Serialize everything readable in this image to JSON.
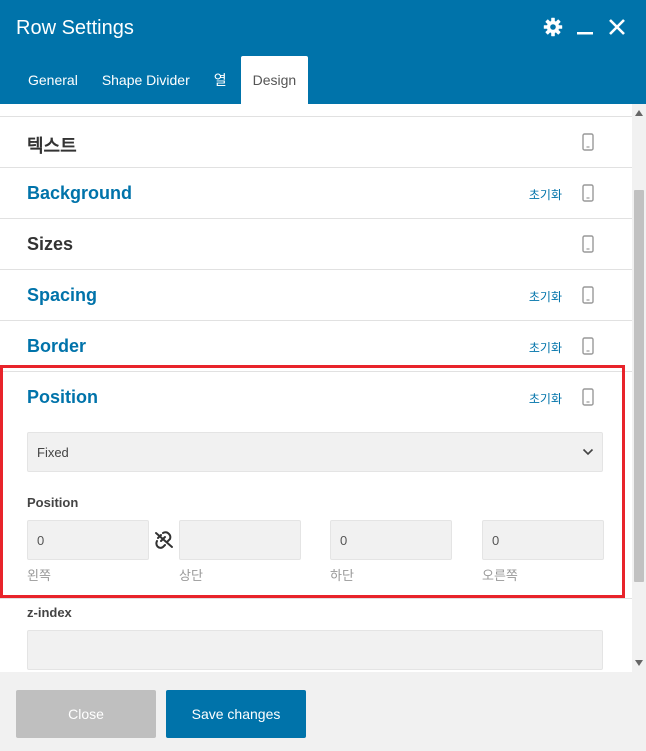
{
  "window": {
    "title": "Row Settings"
  },
  "tabs": [
    {
      "label": "General"
    },
    {
      "label": "Shape Divider"
    },
    {
      "label": "열"
    },
    {
      "label": "Design"
    }
  ],
  "sections": [
    {
      "title": "텍스트",
      "has_reset": false
    },
    {
      "title": "Background",
      "has_reset": true
    },
    {
      "title": "Sizes",
      "has_reset": false
    },
    {
      "title": "Spacing",
      "has_reset": true
    },
    {
      "title": "Border",
      "has_reset": true
    },
    {
      "title": "Position",
      "has_reset": true
    }
  ],
  "reset_label": "초기화",
  "position": {
    "select_value": "Fixed",
    "group_label": "Position",
    "inputs": [
      {
        "value": "0",
        "sublabel": "왼쪽"
      },
      {
        "value": "",
        "sublabel": "상단"
      },
      {
        "value": "0",
        "sublabel": "하단"
      },
      {
        "value": "0",
        "sublabel": "오른쪽"
      }
    ]
  },
  "zindex": {
    "label": "z-index",
    "value": ""
  },
  "footer": {
    "close_label": "Close",
    "save_label": "Save changes"
  },
  "colors": {
    "header": "#0073aa",
    "accent": "#0073aa",
    "highlight": "#e8232a"
  }
}
